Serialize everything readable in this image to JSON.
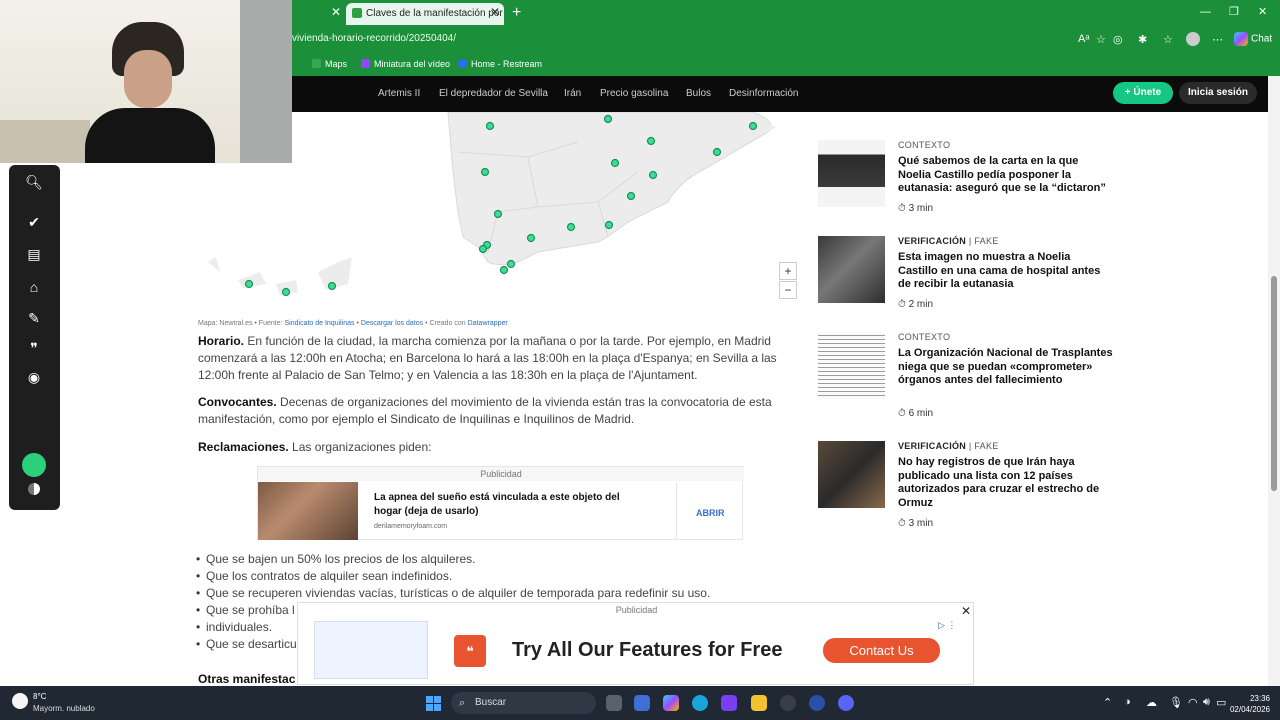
{
  "browser": {
    "tabs": [
      {
        "label": ""
      },
      {
        "label": "Claves de la manifestación por la v"
      }
    ],
    "url": "vivienda-horario-recorrido/20250404/",
    "chat_label": "Chat",
    "bookmarks": [
      "Maps",
      "Miniatura del vídeo",
      "Home - Restream"
    ]
  },
  "nav": {
    "links": [
      "Artemis II",
      "El depredador de Sevilla",
      "Irán",
      "Precio gasolina",
      "Bulos",
      "Desinformación"
    ],
    "join_label": "+ Únete",
    "login_label": "Inicia sesión"
  },
  "map": {
    "caption_prefix": "Mapa: Newtral.es • Fuente: ",
    "caption_source": "Sindicato de Inquilinas",
    "caption_sep": " • ",
    "caption_download": "Descargar los datos",
    "caption_mid": " • Creado con ",
    "caption_tool": "Datawrapper",
    "zoom_in": "+",
    "zoom_out": "−"
  },
  "article": {
    "horario_label": "Horario.",
    "horario_text": " En función de la ciudad, la marcha comienza por la mañana o por la tarde. Por ejemplo, en Madrid comenzará a las 12:00h en Atocha; en Barcelona lo hará a las 18:00h en la plaça d'Espanya; en Sevilla a las 12:00h frente al Palacio de San Telmo; y en Valencia a las 18:30h en la plaça de l'Ajuntament.",
    "convocantes_label": "Convocantes.",
    "convocantes_text": " Decenas de organizaciones del movimiento de la vivienda están tras la convocatoria de esta manifestación, como por ejemplo el Sindicato de Inquilinas e Inquilinos de Madrid.",
    "reclamaciones_label": "Reclamaciones.",
    "reclamaciones_text": " Las organizaciones piden:",
    "bullets": [
      "Que se bajen un 50% los precios de los alquileres.",
      "Que los contratos de alquiler sean indefinidos.",
      "Que se recuperen viviendas vacías, turísticas o de alquiler de temporada para redefinir su uso.",
      "Que se prohíba l",
      "individuales.",
      "Que se desarticu"
    ],
    "otras_heading": "Otras manifestac"
  },
  "inline_ad": {
    "label": "Publicidad",
    "title": "La apnea del sueño está vinculada a este objeto del hogar (deja de usarlo)",
    "domain": "derilamemoryfoam.com",
    "cta": "ABRIR"
  },
  "sidebar": {
    "articles": [
      {
        "kicker": "CONTEXTO",
        "tag": "",
        "headline": "Qué sabemos de la carta en la que Noelia Castillo pedía posponer la eutanasia: aseguró que se la “dictaron”",
        "time": "3 min"
      },
      {
        "kicker": "VERIFICACIÓN",
        "tag": " | FAKE",
        "headline": "Esta imagen no muestra a Noelia Castillo en una cama de hospital antes de recibir la eutanasia",
        "time": "2 min"
      },
      {
        "kicker": "CONTEXTO",
        "tag": "",
        "headline": "La Organización Nacional de Trasplantes niega que se puedan «comprometer» órganos antes del fallecimiento",
        "time": "6 min"
      },
      {
        "kicker": "VERIFICACIÓN",
        "tag": " | FAKE",
        "headline": "No hay registros de que Irán haya publicado una lista con 12 países autorizados para cruzar el estrecho de Ormuz",
        "time": "3 min"
      }
    ]
  },
  "bottom_ad": {
    "label": "Publicidad",
    "title": "Try All Our Features for Free",
    "cta": "Contact Us"
  },
  "taskbar": {
    "temp": "8°C",
    "weather": "Mayorm. nublado",
    "search_label": "Buscar",
    "time": "23:36",
    "date": "02/04/2026"
  },
  "colors": {
    "browser_green": "#1c8f3a",
    "brand_green": "#16c784",
    "map_dot": "#3ddc97",
    "ad_orange": "#e8542f"
  }
}
